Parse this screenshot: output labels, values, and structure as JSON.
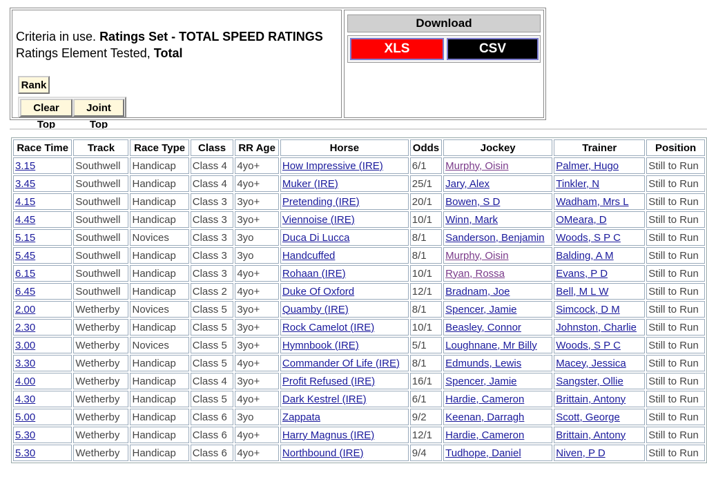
{
  "criteria": {
    "line1_prefix": "Criteria in use.",
    "line1_bold": "Ratings Set - TOTAL SPEED RATINGS",
    "line2_prefix": "Ratings Element Tested,",
    "line2_bold": "Total"
  },
  "buttons": {
    "rank": "Rank",
    "clear_top": "Clear Top",
    "joint_top": "Joint Top"
  },
  "download": {
    "header": "Download",
    "xls": "XLS",
    "csv": "CSV"
  },
  "colors": {
    "xls": "#ff0000",
    "csv": "#000000",
    "link": "#1a1a9c",
    "visited_link": "#7a3a8a",
    "button_bg": "#fff8dc"
  },
  "table": {
    "headers": [
      "Race Time",
      "Track",
      "Race Type",
      "Class",
      "RR Age",
      "Horse",
      "Odds",
      "Jockey",
      "Trainer",
      "Position"
    ],
    "rows": [
      {
        "time": "3.15",
        "track": "Southwell",
        "type": "Handicap",
        "class": "Class 4",
        "age": "4yo+",
        "horse": "How Impressive (IRE)",
        "odds": "6/1",
        "jockey": "Murphy, Oisin",
        "jockey_visited": true,
        "trainer": "Palmer, Hugo",
        "position": "Still to Run"
      },
      {
        "time": "3.45",
        "track": "Southwell",
        "type": "Handicap",
        "class": "Class 4",
        "age": "4yo+",
        "horse": "Muker (IRE)",
        "odds": "25/1",
        "jockey": "Jary, Alex",
        "jockey_visited": false,
        "trainer": "Tinkler, N",
        "position": "Still to Run"
      },
      {
        "time": "4.15",
        "track": "Southwell",
        "type": "Handicap",
        "class": "Class 3",
        "age": "3yo+",
        "horse": "Pretending (IRE)",
        "odds": "20/1",
        "jockey": "Bowen, S D",
        "jockey_visited": false,
        "trainer": "Wadham, Mrs L",
        "position": "Still to Run"
      },
      {
        "time": "4.45",
        "track": "Southwell",
        "type": "Handicap",
        "class": "Class 3",
        "age": "3yo+",
        "horse": "Viennoise (IRE)",
        "odds": "10/1",
        "jockey": "Winn, Mark",
        "jockey_visited": false,
        "trainer": "OMeara, D",
        "position": "Still to Run"
      },
      {
        "time": "5.15",
        "track": "Southwell",
        "type": "Novices",
        "class": "Class 3",
        "age": "3yo",
        "horse": "Duca Di Lucca",
        "odds": "8/1",
        "jockey": "Sanderson, Benjamin",
        "jockey_visited": false,
        "trainer": "Woods, S P C",
        "position": "Still to Run"
      },
      {
        "time": "5.45",
        "track": "Southwell",
        "type": "Handicap",
        "class": "Class 3",
        "age": "3yo",
        "horse": "Handcuffed",
        "odds": "8/1",
        "jockey": "Murphy, Oisin",
        "jockey_visited": true,
        "trainer": "Balding, A M",
        "position": "Still to Run"
      },
      {
        "time": "6.15",
        "track": "Southwell",
        "type": "Handicap",
        "class": "Class 3",
        "age": "4yo+",
        "horse": "Rohaan (IRE)",
        "odds": "10/1",
        "jockey": "Ryan, Rossa",
        "jockey_visited": true,
        "trainer": "Evans, P D",
        "position": "Still to Run"
      },
      {
        "time": "6.45",
        "track": "Southwell",
        "type": "Handicap",
        "class": "Class 2",
        "age": "4yo+",
        "horse": "Duke Of Oxford",
        "odds": "12/1",
        "jockey": "Bradnam, Joe",
        "jockey_visited": false,
        "trainer": "Bell, M L W",
        "position": "Still to Run"
      },
      {
        "time": "2.00",
        "track": "Wetherby",
        "type": "Novices",
        "class": "Class 5",
        "age": "3yo+",
        "horse": "Quamby (IRE)",
        "odds": "8/1",
        "jockey": "Spencer, Jamie",
        "jockey_visited": false,
        "trainer": "Simcock, D M",
        "position": "Still to Run"
      },
      {
        "time": "2.30",
        "track": "Wetherby",
        "type": "Handicap",
        "class": "Class 5",
        "age": "3yo+",
        "horse": "Rock Camelot (IRE)",
        "odds": "10/1",
        "jockey": "Beasley, Connor",
        "jockey_visited": false,
        "trainer": "Johnston, Charlie",
        "position": "Still to Run"
      },
      {
        "time": "3.00",
        "track": "Wetherby",
        "type": "Novices",
        "class": "Class 5",
        "age": "3yo+",
        "horse": "Hymnbook (IRE)",
        "odds": "5/1",
        "jockey": "Loughnane, Mr Billy",
        "jockey_visited": false,
        "trainer": "Woods, S P C",
        "position": "Still to Run"
      },
      {
        "time": "3.30",
        "track": "Wetherby",
        "type": "Handicap",
        "class": "Class 5",
        "age": "4yo+",
        "horse": "Commander Of Life (IRE)",
        "odds": "8/1",
        "jockey": "Edmunds, Lewis",
        "jockey_visited": false,
        "trainer": "Macey, Jessica",
        "position": "Still to Run"
      },
      {
        "time": "4.00",
        "track": "Wetherby",
        "type": "Handicap",
        "class": "Class 4",
        "age": "3yo+",
        "horse": "Profit Refused (IRE)",
        "odds": "16/1",
        "jockey": "Spencer, Jamie",
        "jockey_visited": false,
        "trainer": "Sangster, Ollie",
        "position": "Still to Run"
      },
      {
        "time": "4.30",
        "track": "Wetherby",
        "type": "Handicap",
        "class": "Class 5",
        "age": "4yo+",
        "horse": "Dark Kestrel (IRE)",
        "odds": "6/1",
        "jockey": "Hardie, Cameron",
        "jockey_visited": false,
        "trainer": "Brittain, Antony",
        "position": "Still to Run"
      },
      {
        "time": "5.00",
        "track": "Wetherby",
        "type": "Handicap",
        "class": "Class 6",
        "age": "3yo",
        "horse": "Zappata",
        "odds": "9/2",
        "jockey": "Keenan, Darragh",
        "jockey_visited": false,
        "trainer": "Scott, George",
        "position": "Still to Run"
      },
      {
        "time": "5.30",
        "track": "Wetherby",
        "type": "Handicap",
        "class": "Class 6",
        "age": "4yo+",
        "horse": "Harry Magnus (IRE)",
        "odds": "12/1",
        "jockey": "Hardie, Cameron",
        "jockey_visited": false,
        "trainer": "Brittain, Antony",
        "position": "Still to Run"
      },
      {
        "time": "5.30",
        "track": "Wetherby",
        "type": "Handicap",
        "class": "Class 6",
        "age": "4yo+",
        "horse": "Northbound (IRE)",
        "odds": "9/4",
        "jockey": "Tudhope, Daniel",
        "jockey_visited": false,
        "trainer": "Niven, P D",
        "position": "Still to Run"
      }
    ]
  }
}
